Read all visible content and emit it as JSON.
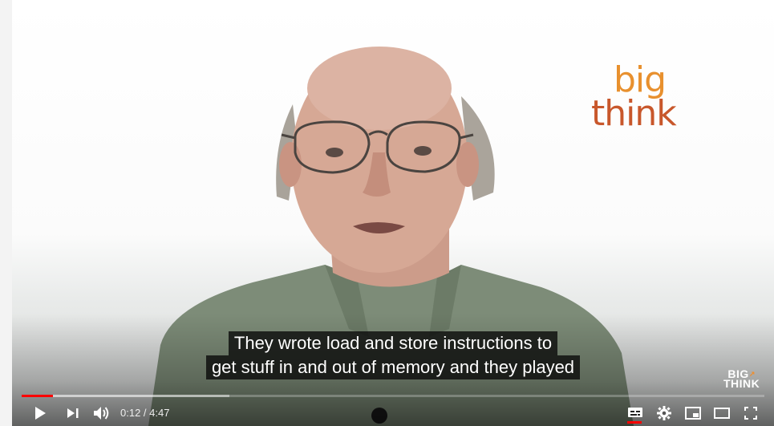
{
  "video": {
    "logo_line1": "big",
    "logo_line2": "think",
    "watermark_line1": "BIG",
    "watermark_line2": "THINK",
    "watermark_accent": "↗",
    "caption_line1": "They wrote load and store instructions to",
    "caption_line2": "get stuff in and out of memory and they played"
  },
  "player": {
    "current_time": "0:12",
    "duration": "4:47",
    "time_display": "0:12 / 4:47",
    "progress_played": 0.042,
    "progress_buffered": 0.28,
    "icons": {
      "play": "play-icon",
      "next": "next-icon",
      "volume": "volume-icon",
      "subtitles": "subtitles-icon",
      "settings": "settings-icon",
      "miniplayer": "miniplayer-icon",
      "theater": "theater-mode-icon",
      "fullscreen": "fullscreen-icon"
    }
  },
  "colors": {
    "progress_red": "#ff0000",
    "logo_orange": "#e8902e",
    "logo_red": "#c8572b"
  }
}
